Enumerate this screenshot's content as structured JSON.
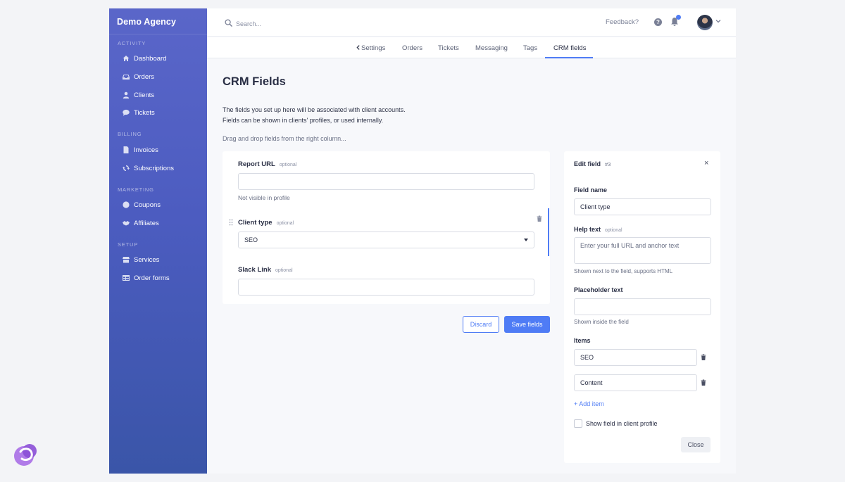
{
  "sidebar": {
    "brand": "Demo Agency",
    "sections": [
      {
        "title": "ACTIVITY",
        "items": [
          {
            "label": "Dashboard",
            "icon": "home-icon"
          },
          {
            "label": "Orders",
            "icon": "inbox-icon"
          },
          {
            "label": "Clients",
            "icon": "user-icon"
          },
          {
            "label": "Tickets",
            "icon": "chat-icon"
          }
        ]
      },
      {
        "title": "BILLING",
        "items": [
          {
            "label": "Invoices",
            "icon": "document-icon"
          },
          {
            "label": "Subscriptions",
            "icon": "refresh-icon"
          }
        ]
      },
      {
        "title": "MARKETING",
        "items": [
          {
            "label": "Coupons",
            "icon": "coupon-icon"
          },
          {
            "label": "Affiliates",
            "icon": "handshake-icon"
          }
        ]
      },
      {
        "title": "SETUP",
        "items": [
          {
            "label": "Services",
            "icon": "store-icon"
          },
          {
            "label": "Order forms",
            "icon": "table-icon"
          }
        ]
      }
    ]
  },
  "topbar": {
    "search_placeholder": "Search...",
    "feedback": "Feedback?",
    "help_glyph": "?"
  },
  "tabs": [
    "Settings",
    "Orders",
    "Tickets",
    "Messaging",
    "Tags",
    "CRM fields"
  ],
  "active_tab": "CRM fields",
  "main": {
    "title": "CRM Fields",
    "desc_line1": "The fields you set up here will be associated with client accounts.",
    "desc_line2": "Fields can be shown in clients' profiles, or used internally.",
    "hint": "Drag and drop fields from the right column...",
    "fields": [
      {
        "label": "Report URL",
        "optional": "optional",
        "value": "",
        "help": "Not visible in profile"
      },
      {
        "label": "Client type",
        "optional": "optional",
        "value": "SEO"
      },
      {
        "label": "Slack Link",
        "optional": "optional",
        "value": ""
      }
    ],
    "discard": "Discard",
    "save": "Save fields"
  },
  "edit_panel": {
    "title": "Edit field",
    "number": "#3",
    "close_glyph": "×",
    "field_name_label": "Field name",
    "field_name_value": "Client type",
    "help_text_label": "Help text",
    "help_text_optional": "optional",
    "help_text_placeholder": "Enter your full URL and anchor text",
    "help_text_hint": "Shown next to the field, supports HTML",
    "placeholder_label": "Placeholder text",
    "placeholder_value": "",
    "placeholder_hint": "Shown inside the field",
    "items_label": "Items",
    "items": [
      "SEO",
      "Content"
    ],
    "add_item": "+ Add item",
    "show_in_profile": "Show field in client profile",
    "show_in_profile_checked": false,
    "close_button": "Close"
  },
  "colors": {
    "accent": "#4f7cf5",
    "sidebar_top": "#5a66c9",
    "sidebar_bottom": "#3a55a8"
  }
}
